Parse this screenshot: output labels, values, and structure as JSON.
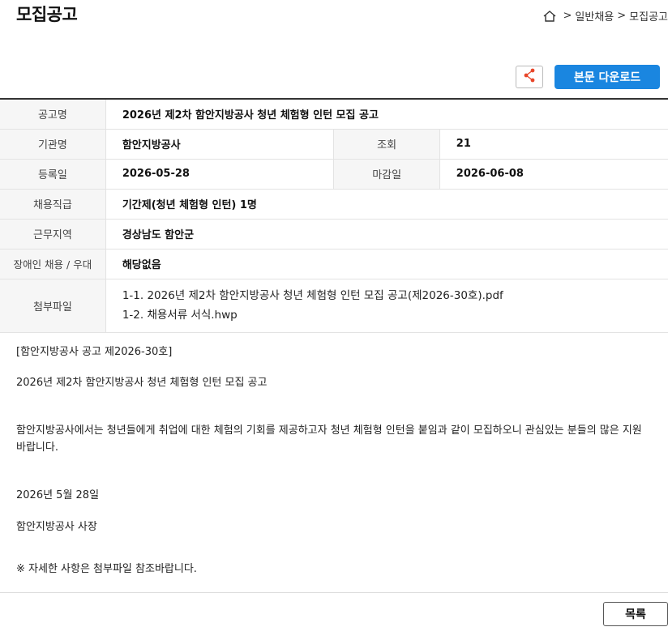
{
  "page_title": "모집공고",
  "breadcrumb": {
    "level1": "일반채용",
    "level2": "모집공고",
    "separator": ">"
  },
  "actions": {
    "download_label": "본문 다운로드"
  },
  "info": {
    "title_label": "공고명",
    "title_value": "2026년 제2차 함안지방공사 청년 체험형 인턴 모집 공고",
    "agency_label": "기관명",
    "agency_value": "함안지방공사",
    "views_label": "조회",
    "views_value": "21",
    "reg_label": "등록일",
    "reg_value": "2026-05-28",
    "deadline_label": "마감일",
    "deadline_value": "2026-06-08",
    "position_label": "채용직급",
    "position_value": "기간제(청년 체험형 인턴) 1명",
    "location_label": "근무지역",
    "location_value": "경상남도 함안군",
    "disability_label": "장애인 채용 / 우대",
    "disability_value": "해당없음",
    "files_label": "첨부파일",
    "files": [
      "1-1. 2026년 제2차 함안지방공사 청년 체험형 인턴 모집 공고(제2026-30호).pdf",
      "1-2. 채용서류 서식.hwp"
    ]
  },
  "body": {
    "notice_no": "[함안지방공사 공고 제2026-30호]",
    "heading": "2026년 제2차 함안지방공사 청년 체험형 인턴 모집 공고",
    "paragraph": "함안지방공사에서는 청년들에게 취업에 대한 체험의 기회를 제공하고자 청년 체험형 인턴을 붙임과 같이 모집하오니 관심있는 분들의 많은 지원 바랍니다.",
    "date": "2026년 5월 28일",
    "signer": "함안지방공사 사장",
    "note": "※ 자세한 사항은 첨부파일 참조바랍니다."
  },
  "footer": {
    "list_label": "목록"
  },
  "colors": {
    "accent": "#1a86e0",
    "share_icon": "#e8472b"
  }
}
